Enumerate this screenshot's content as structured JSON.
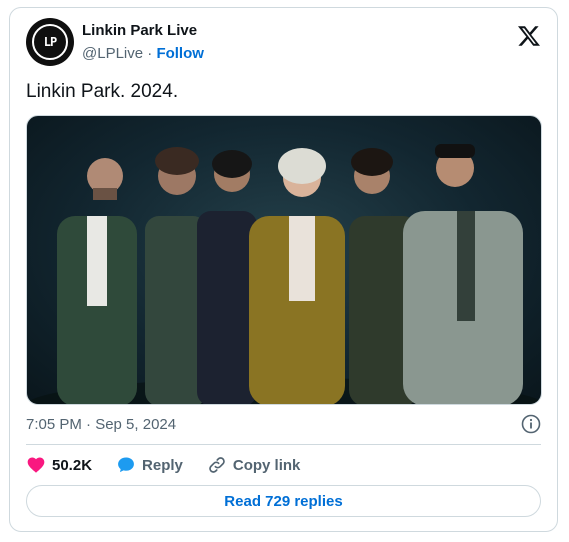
{
  "author": {
    "name": "Linkin Park Live",
    "handle": "@LPLive",
    "separator": " · ",
    "follow_label": "Follow",
    "avatar_text": "LP"
  },
  "tweet": {
    "text": "Linkin Park. 2024.",
    "timestamp": "7:05 PM · Sep 5, 2024"
  },
  "actions": {
    "like_count": "50.2K",
    "reply_label": "Reply",
    "copy_link_label": "Copy link"
  },
  "replies_button": "Read 729 replies",
  "icons": {
    "brand": "x-logo-icon",
    "info": "info-icon",
    "like": "heart-icon",
    "reply": "speech-bubble-icon",
    "copy": "link-icon"
  },
  "colors": {
    "like": "#f91880",
    "reply": "#1d9bf0",
    "follow": "#006fd6"
  }
}
